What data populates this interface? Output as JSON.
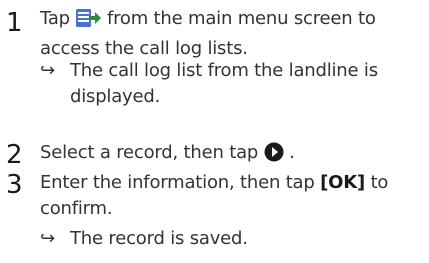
{
  "steps": [
    {
      "number": "1",
      "text_before_icon": "Tap ",
      "icon": "call-log-icon",
      "text_after_icon": " from the main menu screen to access the call log lists.",
      "result": "The call log list from the landline is displayed."
    },
    {
      "number": "2",
      "text_before_icon": "Select a record, then tap ",
      "icon": "play-circle-icon",
      "text_after_icon": "."
    },
    {
      "number": "3",
      "text_before_key": "Enter the information, then tap ",
      "key_label": "[OK]",
      "text_after_key": " to confirm.",
      "result": "The record is saved."
    }
  ],
  "result_arrow": "↪",
  "colors": {
    "text": "#333333",
    "icon_blue": "#4a6fd6",
    "icon_green": "#2e8b3a",
    "icon_dark": "#1a1a1a"
  }
}
